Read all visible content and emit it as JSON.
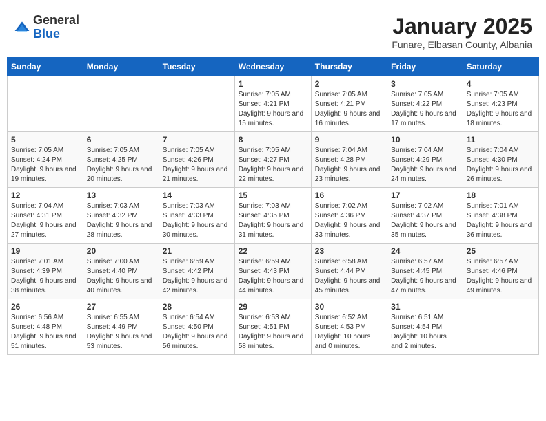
{
  "header": {
    "logo_general": "General",
    "logo_blue": "Blue",
    "month_title": "January 2025",
    "location": "Funare, Elbasan County, Albania"
  },
  "days_of_week": [
    "Sunday",
    "Monday",
    "Tuesday",
    "Wednesday",
    "Thursday",
    "Friday",
    "Saturday"
  ],
  "weeks": [
    [
      {
        "num": "",
        "detail": ""
      },
      {
        "num": "",
        "detail": ""
      },
      {
        "num": "",
        "detail": ""
      },
      {
        "num": "1",
        "detail": "Sunrise: 7:05 AM\nSunset: 4:21 PM\nDaylight: 9 hours\nand 15 minutes."
      },
      {
        "num": "2",
        "detail": "Sunrise: 7:05 AM\nSunset: 4:21 PM\nDaylight: 9 hours\nand 16 minutes."
      },
      {
        "num": "3",
        "detail": "Sunrise: 7:05 AM\nSunset: 4:22 PM\nDaylight: 9 hours\nand 17 minutes."
      },
      {
        "num": "4",
        "detail": "Sunrise: 7:05 AM\nSunset: 4:23 PM\nDaylight: 9 hours\nand 18 minutes."
      }
    ],
    [
      {
        "num": "5",
        "detail": "Sunrise: 7:05 AM\nSunset: 4:24 PM\nDaylight: 9 hours\nand 19 minutes."
      },
      {
        "num": "6",
        "detail": "Sunrise: 7:05 AM\nSunset: 4:25 PM\nDaylight: 9 hours\nand 20 minutes."
      },
      {
        "num": "7",
        "detail": "Sunrise: 7:05 AM\nSunset: 4:26 PM\nDaylight: 9 hours\nand 21 minutes."
      },
      {
        "num": "8",
        "detail": "Sunrise: 7:05 AM\nSunset: 4:27 PM\nDaylight: 9 hours\nand 22 minutes."
      },
      {
        "num": "9",
        "detail": "Sunrise: 7:04 AM\nSunset: 4:28 PM\nDaylight: 9 hours\nand 23 minutes."
      },
      {
        "num": "10",
        "detail": "Sunrise: 7:04 AM\nSunset: 4:29 PM\nDaylight: 9 hours\nand 24 minutes."
      },
      {
        "num": "11",
        "detail": "Sunrise: 7:04 AM\nSunset: 4:30 PM\nDaylight: 9 hours\nand 26 minutes."
      }
    ],
    [
      {
        "num": "12",
        "detail": "Sunrise: 7:04 AM\nSunset: 4:31 PM\nDaylight: 9 hours\nand 27 minutes."
      },
      {
        "num": "13",
        "detail": "Sunrise: 7:03 AM\nSunset: 4:32 PM\nDaylight: 9 hours\nand 28 minutes."
      },
      {
        "num": "14",
        "detail": "Sunrise: 7:03 AM\nSunset: 4:33 PM\nDaylight: 9 hours\nand 30 minutes."
      },
      {
        "num": "15",
        "detail": "Sunrise: 7:03 AM\nSunset: 4:35 PM\nDaylight: 9 hours\nand 31 minutes."
      },
      {
        "num": "16",
        "detail": "Sunrise: 7:02 AM\nSunset: 4:36 PM\nDaylight: 9 hours\nand 33 minutes."
      },
      {
        "num": "17",
        "detail": "Sunrise: 7:02 AM\nSunset: 4:37 PM\nDaylight: 9 hours\nand 35 minutes."
      },
      {
        "num": "18",
        "detail": "Sunrise: 7:01 AM\nSunset: 4:38 PM\nDaylight: 9 hours\nand 36 minutes."
      }
    ],
    [
      {
        "num": "19",
        "detail": "Sunrise: 7:01 AM\nSunset: 4:39 PM\nDaylight: 9 hours\nand 38 minutes."
      },
      {
        "num": "20",
        "detail": "Sunrise: 7:00 AM\nSunset: 4:40 PM\nDaylight: 9 hours\nand 40 minutes."
      },
      {
        "num": "21",
        "detail": "Sunrise: 6:59 AM\nSunset: 4:42 PM\nDaylight: 9 hours\nand 42 minutes."
      },
      {
        "num": "22",
        "detail": "Sunrise: 6:59 AM\nSunset: 4:43 PM\nDaylight: 9 hours\nand 44 minutes."
      },
      {
        "num": "23",
        "detail": "Sunrise: 6:58 AM\nSunset: 4:44 PM\nDaylight: 9 hours\nand 45 minutes."
      },
      {
        "num": "24",
        "detail": "Sunrise: 6:57 AM\nSunset: 4:45 PM\nDaylight: 9 hours\nand 47 minutes."
      },
      {
        "num": "25",
        "detail": "Sunrise: 6:57 AM\nSunset: 4:46 PM\nDaylight: 9 hours\nand 49 minutes."
      }
    ],
    [
      {
        "num": "26",
        "detail": "Sunrise: 6:56 AM\nSunset: 4:48 PM\nDaylight: 9 hours\nand 51 minutes."
      },
      {
        "num": "27",
        "detail": "Sunrise: 6:55 AM\nSunset: 4:49 PM\nDaylight: 9 hours\nand 53 minutes."
      },
      {
        "num": "28",
        "detail": "Sunrise: 6:54 AM\nSunset: 4:50 PM\nDaylight: 9 hours\nand 56 minutes."
      },
      {
        "num": "29",
        "detail": "Sunrise: 6:53 AM\nSunset: 4:51 PM\nDaylight: 9 hours\nand 58 minutes."
      },
      {
        "num": "30",
        "detail": "Sunrise: 6:52 AM\nSunset: 4:53 PM\nDaylight: 10 hours\nand 0 minutes."
      },
      {
        "num": "31",
        "detail": "Sunrise: 6:51 AM\nSunset: 4:54 PM\nDaylight: 10 hours\nand 2 minutes."
      },
      {
        "num": "",
        "detail": ""
      }
    ]
  ]
}
